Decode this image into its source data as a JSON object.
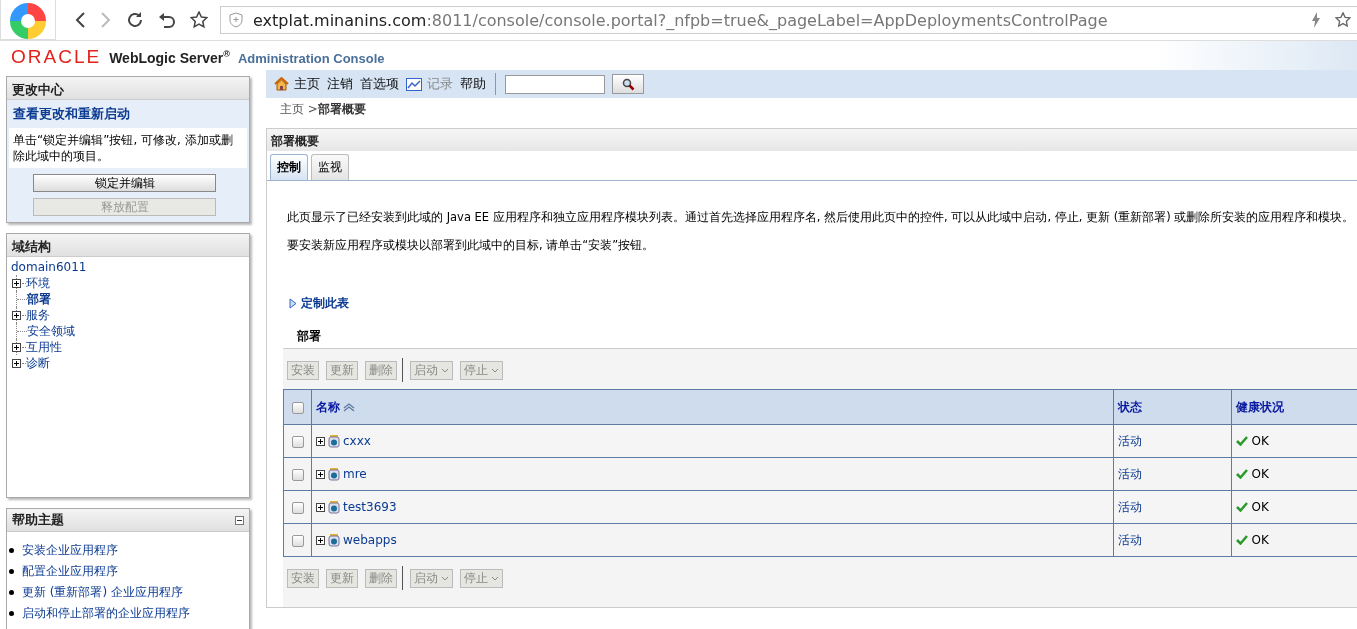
{
  "browser": {
    "url_host": "extplat.minanins.com",
    "url_path": ":8011/console/console.portal?_nfpb=true&_pageLabel=AppDeploymentsControlPage"
  },
  "header": {
    "brand": "ORACLE",
    "product": "WebLogic Server$^{®}$",
    "subtitle": "Administration Console"
  },
  "change_center": {
    "title": "更改中心",
    "link": "查看更改和重新启动",
    "message": "单击“锁定并编辑”按钮, 可修改, 添加或删除此域中的项目。",
    "buttons": [
      {
        "label": "锁定并编辑",
        "disabled": false
      },
      {
        "label": "释放配置",
        "disabled": true
      }
    ]
  },
  "domain_structure": {
    "title": "域结构",
    "tree": {
      "label": "domain6011",
      "children": [
        {
          "label": "环境",
          "expandable": true,
          "selected": false
        },
        {
          "label": "部署",
          "expandable": false,
          "selected": true
        },
        {
          "label": "服务",
          "expandable": true,
          "selected": false
        },
        {
          "label": "安全领域",
          "expandable": false,
          "selected": false
        },
        {
          "label": "互用性",
          "expandable": true,
          "selected": false
        },
        {
          "label": "诊断",
          "expandable": true,
          "selected": false
        }
      ]
    }
  },
  "help_topics": {
    "title": "帮助主题",
    "links": [
      "安装企业应用程序",
      "配置企业应用程序",
      "更新 (重新部署) 企业应用程序",
      "启动和停止部署的企业应用程序"
    ]
  },
  "toolbar": {
    "items": [
      {
        "label": "主页",
        "kind": "home",
        "disabled": false
      },
      {
        "label": "注销",
        "kind": "plain",
        "disabled": false
      },
      {
        "label": "首选项",
        "kind": "plain",
        "disabled": false
      },
      {
        "label": "记录",
        "kind": "record",
        "disabled": true
      },
      {
        "label": "帮助",
        "kind": "plain",
        "disabled": false
      }
    ]
  },
  "breadcrumb": {
    "link": "主页 >",
    "current": "部署概要"
  },
  "panel": {
    "title": "部署概要",
    "tabs": [
      {
        "label": "控制",
        "selected": true
      },
      {
        "label": "监视",
        "selected": false
      }
    ],
    "paragraphs": [
      "此页显示了已经安装到此域的 Java EE 应用程序和独立应用程序模块列表。通过首先选择应用程序名, 然后使用此页中的控件, 可以从此域中启动, 停止, 更新 (重新部署) 或删除所安装的应用程序和模块。",
      "要安装新应用程序或模块以部署到此域中的目标, 请单击“安装”按钮。"
    ],
    "customize_link": "定制此表",
    "table_title": "部署",
    "top_actions": [
      {
        "label": "安装",
        "kind": "button",
        "disabled": true
      },
      {
        "label": "更新",
        "kind": "button",
        "disabled": true
      },
      {
        "label": "删除",
        "kind": "button",
        "disabled": true
      },
      {
        "label": "启动",
        "kind": "menu",
        "disabled": true
      },
      {
        "label": "停止",
        "kind": "menu",
        "disabled": true
      }
    ],
    "bottom_actions": [
      {
        "label": "安装",
        "kind": "button",
        "disabled": true
      },
      {
        "label": "更新",
        "kind": "button",
        "disabled": true
      },
      {
        "label": "删除",
        "kind": "button",
        "disabled": true
      },
      {
        "label": "启动",
        "kind": "menu",
        "disabled": true
      },
      {
        "label": "停止",
        "kind": "menu",
        "disabled": true
      }
    ],
    "header_checkbox": {
      "checked": false
    },
    "columns": [
      "名称",
      "状态",
      "健康状况"
    ],
    "rows": [
      {
        "name": "cxxx",
        "checked": false,
        "state": "活动",
        "health": "OK"
      },
      {
        "name": "mre",
        "checked": false,
        "state": "活动",
        "health": "OK"
      },
      {
        "name": "test3693",
        "checked": false,
        "state": "活动",
        "health": "OK"
      },
      {
        "name": "webapps",
        "checked": false,
        "state": "活动",
        "health": "OK"
      }
    ]
  }
}
